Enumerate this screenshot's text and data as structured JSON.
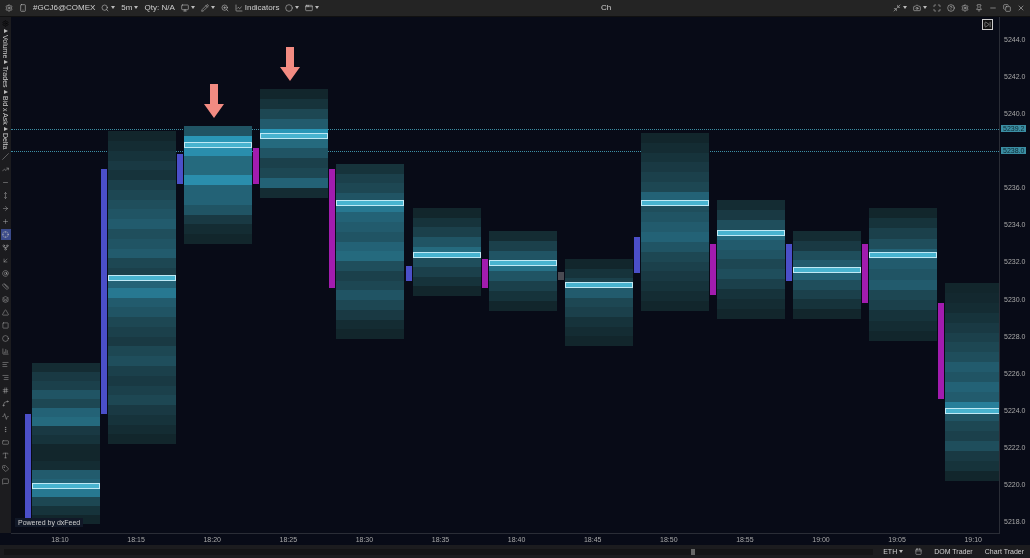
{
  "top_bar": {
    "symbol": "#GCJ6@COMEX",
    "interval": "5m",
    "quantity": "Qty: N/A",
    "indicators": "Indicators",
    "title": "Ch"
  },
  "left_toolbar": {
    "studies": [
      "Volume",
      "Trades",
      "Bid x Ask",
      "Delta"
    ],
    "tools": [
      {
        "selected": false
      },
      {
        "selected": false
      },
      {
        "selected": false
      },
      {
        "selected": false
      },
      {
        "selected": false
      },
      {
        "selected": false
      },
      {
        "selected": true
      },
      {
        "selected": false
      },
      {
        "selected": false
      },
      {
        "selected": false
      },
      {
        "selected": false
      },
      {
        "selected": false
      },
      {
        "selected": false
      },
      {
        "selected": false
      },
      {
        "selected": false
      },
      {
        "selected": false
      },
      {
        "selected": false
      },
      {
        "selected": false
      },
      {
        "selected": false
      },
      {
        "selected": false
      },
      {
        "selected": false
      },
      {
        "selected": false
      },
      {
        "selected": false
      },
      {
        "selected": false
      },
      {
        "selected": false
      },
      {
        "selected": false
      }
    ]
  },
  "price_lines": [
    {
      "label": "5239.2"
    },
    {
      "label": "5238.0"
    }
  ],
  "price_axis": [
    "5244.0",
    "5242.0",
    "5240.0",
    "5236.0",
    "5234.0",
    "5232.0",
    "5230.0",
    "5228.0",
    "5226.0",
    "5224.0",
    "5222.0",
    "5220.0",
    "5218.0"
  ],
  "time_axis": [
    "18:10",
    "18:15",
    "18:20",
    "18:25",
    "18:30",
    "18:35",
    "18:40",
    "18:45",
    "18:50",
    "18:55",
    "19:00",
    "19:05",
    "19:10"
  ],
  "watermark_note": "Powered by dxFeed",
  "status_bar": {
    "session": "ETH",
    "buttons": [
      "DOM Trader",
      "Chart Trader"
    ]
  }
}
